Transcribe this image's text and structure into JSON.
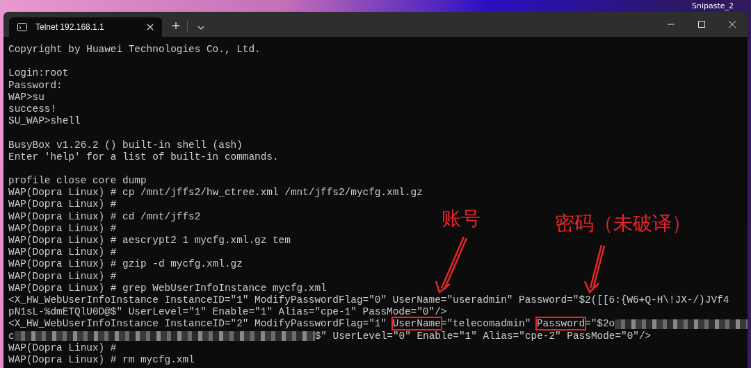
{
  "desktop": {
    "icon_label": "Snipaste_2"
  },
  "tab": {
    "title": "Telnet 192.168.1.1",
    "selected": true
  },
  "terminal": {
    "lines": [
      {
        "kind": "text",
        "text": "Copyright by Huawei Technologies Co., Ltd."
      },
      {
        "kind": "blank"
      },
      {
        "kind": "text",
        "text": "Login:root"
      },
      {
        "kind": "text",
        "text": "Password:"
      },
      {
        "kind": "text",
        "text": "WAP>su"
      },
      {
        "kind": "text",
        "text": "success!"
      },
      {
        "kind": "text",
        "text": "SU_WAP>shell"
      },
      {
        "kind": "blank"
      },
      {
        "kind": "text",
        "text": "BusyBox v1.26.2 () built-in shell (ash)"
      },
      {
        "kind": "text",
        "text": "Enter 'help' for a list of built-in commands."
      },
      {
        "kind": "blank"
      },
      {
        "kind": "text",
        "text": "profile close core dump"
      },
      {
        "kind": "text",
        "text": "WAP(Dopra Linux) # cp /mnt/jffs2/hw_ctree.xml /mnt/jffs2/mycfg.xml.gz"
      },
      {
        "kind": "text",
        "text": "WAP(Dopra Linux) #"
      },
      {
        "kind": "text",
        "text": "WAP(Dopra Linux) # cd /mnt/jffs2"
      },
      {
        "kind": "text",
        "text": "WAP(Dopra Linux) #"
      },
      {
        "kind": "text",
        "text": "WAP(Dopra Linux) # aescrypt2 1 mycfg.xml.gz tem"
      },
      {
        "kind": "text",
        "text": "WAP(Dopra Linux) #"
      },
      {
        "kind": "text",
        "text": "WAP(Dopra Linux) # gzip -d mycfg.xml.gz"
      },
      {
        "kind": "text",
        "text": "WAP(Dopra Linux) #"
      },
      {
        "kind": "text",
        "text": "WAP(Dopra Linux) # grep WebUserInfoInstance mycfg.xml"
      },
      {
        "kind": "text",
        "text": "<X_HW_WebUserInfoInstance InstanceID=\"1\" ModifyPasswordFlag=\"0\" UserName=\"useradmin\" Password=\"$2([[6:{W6+Q-H\\!JX-/)JVf4"
      },
      {
        "kind": "text",
        "text": "pN1sL-%dmETQlU0D@$\" UserLevel=\"1\" Enable=\"1\" Alias=\"cpe-1\" PassMode=\"0\"/>"
      },
      {
        "kind": "segments",
        "segments": [
          {
            "kind": "text",
            "text": "<X_HW_WebUserInfoInstance InstanceID=\"2\" ModifyPasswordFlag=\"1\" "
          },
          {
            "kind": "boxed",
            "text": "UserName"
          },
          {
            "kind": "text",
            "text": "=\"telecomadmin\" "
          },
          {
            "kind": "boxed",
            "text": "Password"
          },
          {
            "kind": "text",
            "text": "=\"$2o"
          },
          {
            "kind": "redacted"
          }
        ]
      },
      {
        "kind": "segments",
        "segments": [
          {
            "kind": "text",
            "text": "c"
          },
          {
            "kind": "redacted"
          },
          {
            "kind": "text",
            "text": "$\" UserLevel=\"0\" Enable=\"1\" Alias=\"cpe-2\" PassMode=\"0\"/>"
          }
        ]
      },
      {
        "kind": "text",
        "text": "WAP(Dopra Linux) #"
      },
      {
        "kind": "text",
        "text": "WAP(Dopra Linux) # rm mycfg.xml"
      }
    ]
  },
  "annotations": [
    {
      "text": "账号"
    },
    {
      "text": "密码（未破译）"
    }
  ]
}
